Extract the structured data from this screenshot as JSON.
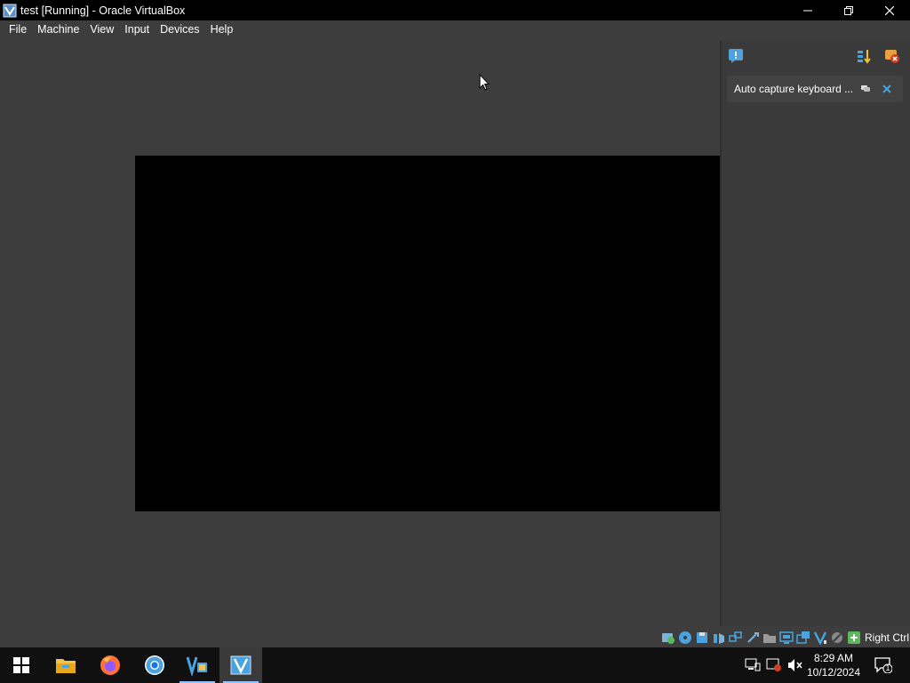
{
  "window": {
    "title": "test [Running] - Oracle VirtualBox"
  },
  "menu": {
    "items": [
      "File",
      "Machine",
      "View",
      "Input",
      "Devices",
      "Help"
    ]
  },
  "notification_center": {
    "message": "Auto capture keyboard ..."
  },
  "statusbar": {
    "host_key": "Right Ctrl"
  },
  "taskbar": {
    "time": "8:29 AM",
    "date": "10/12/2024",
    "notification_count": "1"
  },
  "colors": {
    "background": "#3d3d3d",
    "vm_screen": "#000000",
    "accent": "#8fc3ff"
  }
}
